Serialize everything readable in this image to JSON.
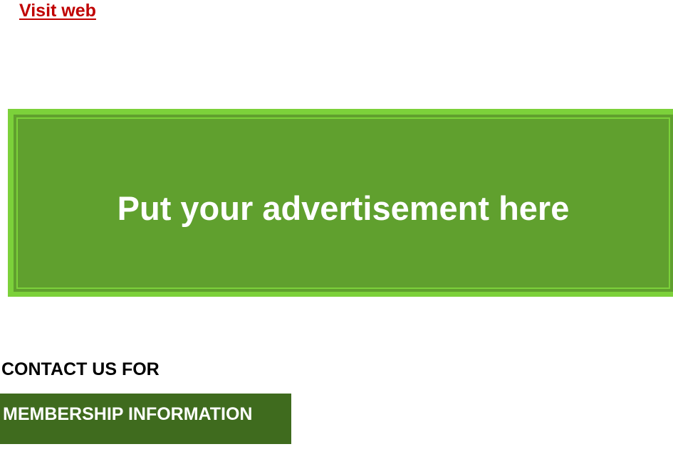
{
  "link": {
    "visit_web": "Visit web",
    "color": "#c00000"
  },
  "advertisement": {
    "text": "Put your advertisement here",
    "outer_color": "#7cd13a",
    "inner_color": "#60a02e"
  },
  "contact": {
    "heading": "CONTACT US FOR",
    "button_label": "MEMBERSHIP INFORMATION",
    "button_color": "#3f6b1e"
  }
}
